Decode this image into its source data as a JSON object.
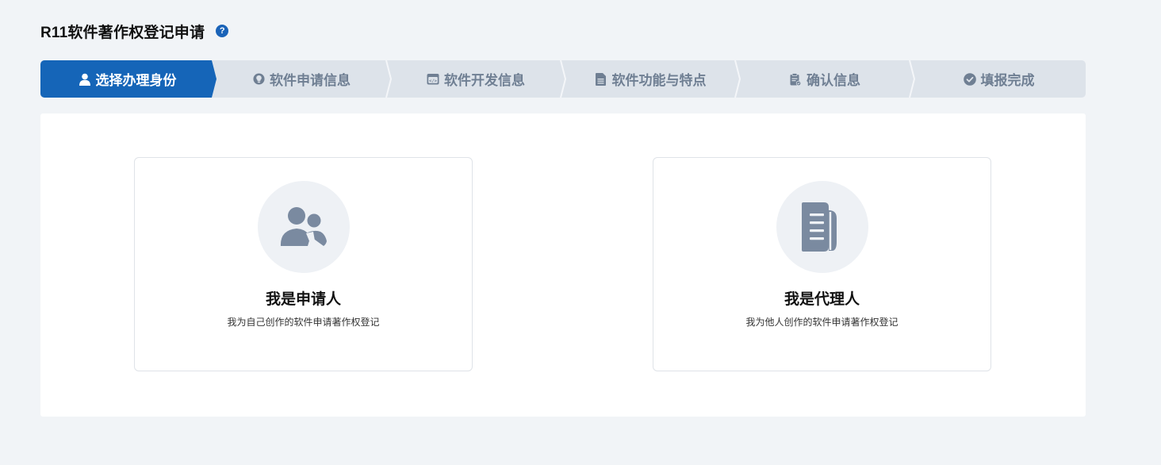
{
  "header": {
    "title": "R11软件著作权登记申请",
    "help_icon": "question-circle-icon"
  },
  "stepper": {
    "steps": [
      {
        "label": "选择办理身份",
        "icon": "user-icon",
        "active": true
      },
      {
        "label": "软件申请信息",
        "icon": "lightbulb-icon",
        "active": false
      },
      {
        "label": "软件开发信息",
        "icon": "calendar-code-icon",
        "active": false
      },
      {
        "label": "软件功能与特点",
        "icon": "document-icon",
        "active": false
      },
      {
        "label": "确认信息",
        "icon": "clipboard-check-icon",
        "active": false
      },
      {
        "label": "填报完成",
        "icon": "check-circle-icon",
        "active": false
      }
    ],
    "active_color": "#1565b8",
    "inactive_color": "#dde3ea",
    "inactive_text_color": "#6f7f93"
  },
  "roles": [
    {
      "title": "我是申请人",
      "description": "我为自己创作的软件申请著作权登记",
      "icon": "users-icon"
    },
    {
      "title": "我是代理人",
      "description": "我为他人创作的软件申请著作权登记",
      "icon": "documents-icon"
    }
  ],
  "colors": {
    "background": "#f1f4f7",
    "icon_gray": "#7a8aa0",
    "accent": "#1565b8"
  }
}
